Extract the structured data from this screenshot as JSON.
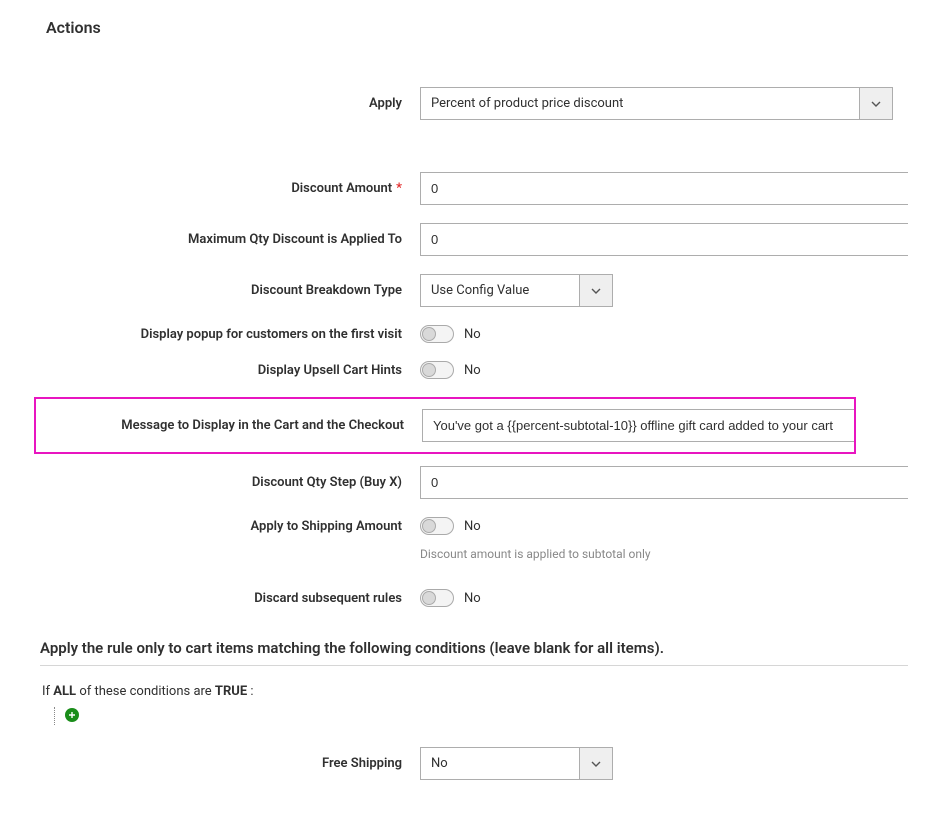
{
  "section_title": "Actions",
  "fields": {
    "apply": {
      "label": "Apply",
      "value": "Percent of product price discount"
    },
    "discount_amount": {
      "label": "Discount Amount",
      "value": "0"
    },
    "max_qty": {
      "label": "Maximum Qty Discount is Applied To",
      "value": "0"
    },
    "breakdown": {
      "label": "Discount Breakdown Type",
      "value": "Use Config Value"
    },
    "popup_first": {
      "label": "Display popup for customers on the first visit",
      "value": "No"
    },
    "upsell_hints": {
      "label": "Display Upsell Cart Hints",
      "value": "No"
    },
    "cart_message": {
      "label": "Message to Display in the Cart and the Checkout",
      "value": "You've got a {{percent-subtotal-10}} offline gift card added to your cart"
    },
    "qty_step": {
      "label": "Discount Qty Step (Buy X)",
      "value": "0"
    },
    "apply_shipping": {
      "label": "Apply to Shipping Amount",
      "value": "No",
      "hint": "Discount amount is applied to subtotal only"
    },
    "discard_rules": {
      "label": "Discard subsequent rules",
      "value": "No"
    },
    "free_shipping": {
      "label": "Free Shipping",
      "value": "No"
    }
  },
  "conditions": {
    "heading": "Apply the rule only to cart items matching the following conditions (leave blank for all items).",
    "prefix": "If ",
    "all": "ALL",
    "mid": " of these conditions are ",
    "true": "TRUE",
    "suffix": " :"
  }
}
